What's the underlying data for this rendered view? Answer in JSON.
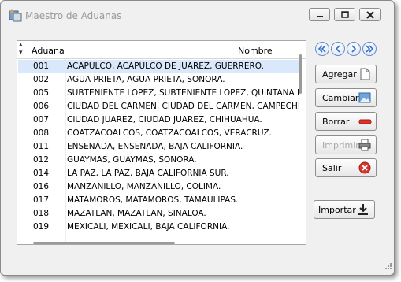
{
  "window": {
    "title": "Maestro de Aduanas"
  },
  "grid": {
    "columns": [
      "Aduana",
      "Nombre"
    ],
    "rows": [
      {
        "code": "001",
        "name": "ACAPULCO, ACAPULCO DE JUAREZ, GUERRERO."
      },
      {
        "code": "002",
        "name": "AGUA PRIETA, AGUA PRIETA, SONORA."
      },
      {
        "code": "005",
        "name": "SUBTENIENTE LOPEZ, SUBTENIENTE LOPEZ, QUINTANA ROO"
      },
      {
        "code": "006",
        "name": "CIUDAD DEL CARMEN, CIUDAD DEL CARMEN, CAMPECHE."
      },
      {
        "code": "007",
        "name": "CIUDAD JUAREZ, CIUDAD JUAREZ, CHIHUAHUA."
      },
      {
        "code": "008",
        "name": "COATZACOALCOS, COATZACOALCOS, VERACRUZ."
      },
      {
        "code": "011",
        "name": "ENSENADA, ENSENADA, BAJA CALIFORNIA."
      },
      {
        "code": "012",
        "name": "GUAYMAS, GUAYMAS, SONORA."
      },
      {
        "code": "014",
        "name": "LA PAZ, LA PAZ, BAJA CALIFORNIA SUR."
      },
      {
        "code": "016",
        "name": "MANZANILLO, MANZANILLO, COLIMA."
      },
      {
        "code": "017",
        "name": "MATAMOROS, MATAMOROS, TAMAULIPAS."
      },
      {
        "code": "018",
        "name": "MAZATLAN, MAZATLAN, SINALOA."
      },
      {
        "code": "019",
        "name": "MEXICALI, MEXICALI, BAJA CALIFORNIA."
      }
    ]
  },
  "buttons": {
    "agregar": "Agregar",
    "cambiar": "Cambiar",
    "borrar": "Borrar",
    "imprimir": "Imprimir",
    "salir": "Salir",
    "importar": "Importar"
  },
  "colors": {
    "selected_row": "#d9e8fb",
    "nav_blue": "#3a6fc8"
  }
}
